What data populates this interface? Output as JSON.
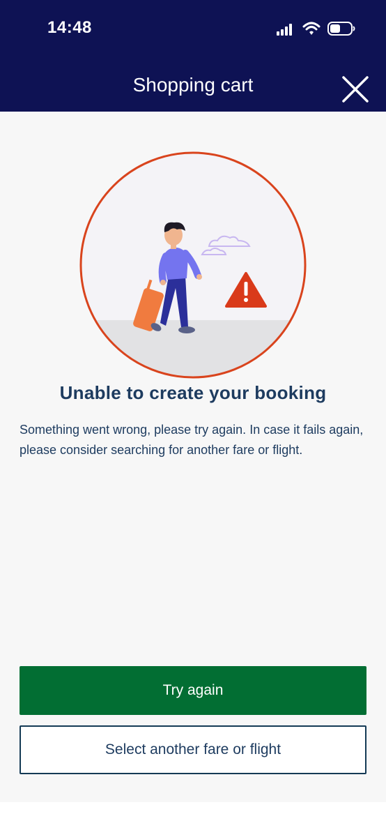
{
  "status_bar": {
    "time": "14:48",
    "icons": [
      "cellular-signal-icon",
      "wifi-icon",
      "battery-icon"
    ]
  },
  "header": {
    "title": "Shopping cart",
    "close_icon": "close-icon"
  },
  "error": {
    "heading": "Unable to create your booking",
    "message": "Something went wrong, please try again. In case it fails again, please consider searching for another fare or flight.",
    "illustration": "traveler-with-suitcase-warning-illustration"
  },
  "actions": {
    "primary_label": "Try again",
    "secondary_label": "Select another fare or flight"
  },
  "colors": {
    "header_bg": "#0e1254",
    "primary_button": "#026e33",
    "text": "#1d3b5f",
    "circle_border": "#d9441d",
    "warning": "#d93a1a"
  }
}
